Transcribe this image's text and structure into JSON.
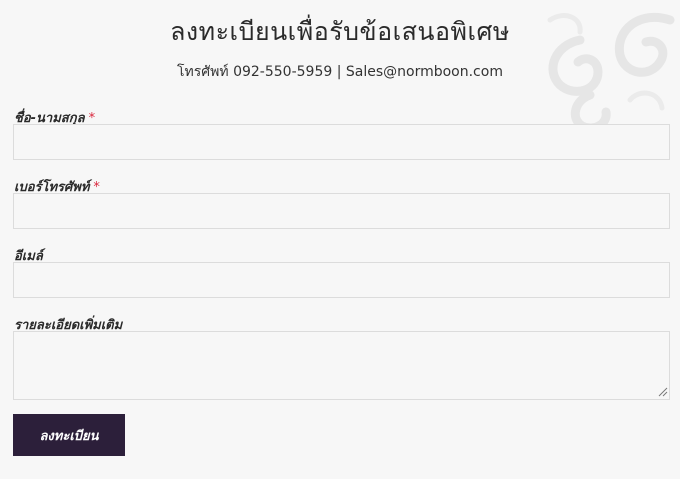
{
  "header": {
    "title": "ลงทะเบียนเพื่อรับข้อเสนอพิเศษ",
    "contact": "โทรศัพท์ 092-550-5959 | Sales@normboon.com"
  },
  "form": {
    "fields": [
      {
        "label": "ชื่อ-นามสกุล",
        "required_mark": "*",
        "value": "",
        "placeholder": ""
      },
      {
        "label": "เบอร์โทรศัพท์",
        "required_mark": "*",
        "value": "",
        "placeholder": ""
      },
      {
        "label": "อีเมล์",
        "required_mark": "",
        "value": "",
        "placeholder": ""
      },
      {
        "label": "รายละเอียดเพิ่มเติม",
        "required_mark": "",
        "value": "",
        "placeholder": ""
      }
    ],
    "submit_label": "ลงทะเบียน"
  },
  "colors": {
    "background": "#f7f7f7",
    "button": "#2c1f3a",
    "required": "#d9263c",
    "decor": "#e6e6e6"
  },
  "icons": {
    "decor": "thai-swirl-ornament",
    "resize": "resize-grip-icon"
  }
}
